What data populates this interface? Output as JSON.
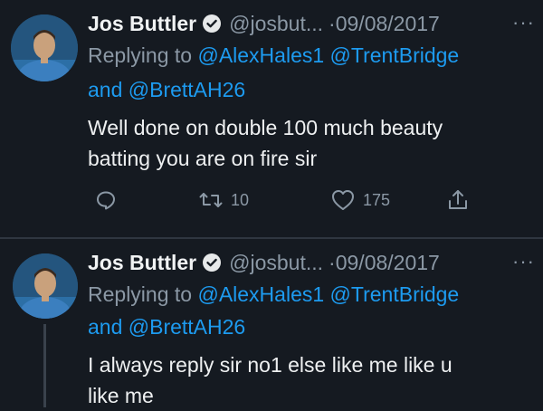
{
  "tweets": [
    {
      "author_name": "Jos Buttler",
      "handle": "@josbut...",
      "separator": "·",
      "date": "09/08/2017",
      "more_label": "···",
      "replying_prefix": "Replying to",
      "replying_mention_1": "@AlexHales1",
      "replying_mention_2": "@TrentBridge",
      "replying_and": "and",
      "replying_mention_3": "@BrettAH26",
      "body_line_1": "Well done on double 100 much beauty",
      "body_line_2": "batting you are on fire sir",
      "retweet_count": "10",
      "like_count": "175"
    },
    {
      "author_name": "Jos Buttler",
      "handle": "@josbut...",
      "separator": "·",
      "date": "09/08/2017",
      "more_label": "···",
      "replying_prefix": "Replying to",
      "replying_mention_1": "@AlexHales1",
      "replying_mention_2": "@TrentBridge",
      "replying_and": "and",
      "replying_mention_3": "@BrettAH26",
      "body_line_1": "I always reply sir no1 else like me like u",
      "body_line_2": "like me"
    }
  ],
  "icons": {
    "verified": "verified-badge-icon",
    "reply": "reply-bubble-icon",
    "retweet": "retweet-icon",
    "like": "heart-icon",
    "share": "share-icon"
  },
  "colors": {
    "background": "#151a21",
    "mention": "#1d9bf0",
    "secondary_text": "#8b98a5",
    "primary_text": "#e7e9ea"
  }
}
